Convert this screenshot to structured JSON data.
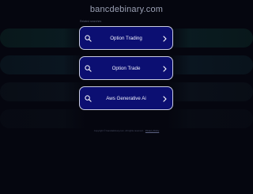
{
  "site": {
    "domain": "bancdebinary.com"
  },
  "related": {
    "label": "Related searches",
    "items": [
      {
        "label": "Option Trading",
        "icon": "search-icon",
        "chevron": "chevron-right-icon"
      },
      {
        "label": "Option Trade",
        "icon": "search-icon",
        "chevron": "chevron-right-icon"
      },
      {
        "label": "Aws Generative Ai",
        "icon": "search-icon",
        "chevron": "chevron-right-icon"
      }
    ]
  },
  "footer": {
    "copyright": "Copyright © bancdebinary.com. All rights reserved.",
    "privacy_label": "Privacy Policy"
  },
  "colors": {
    "background": "#05060f",
    "button_fill": "#0c0f72",
    "button_border": "#c8cbe0",
    "title_text": "#9aa0b4"
  }
}
